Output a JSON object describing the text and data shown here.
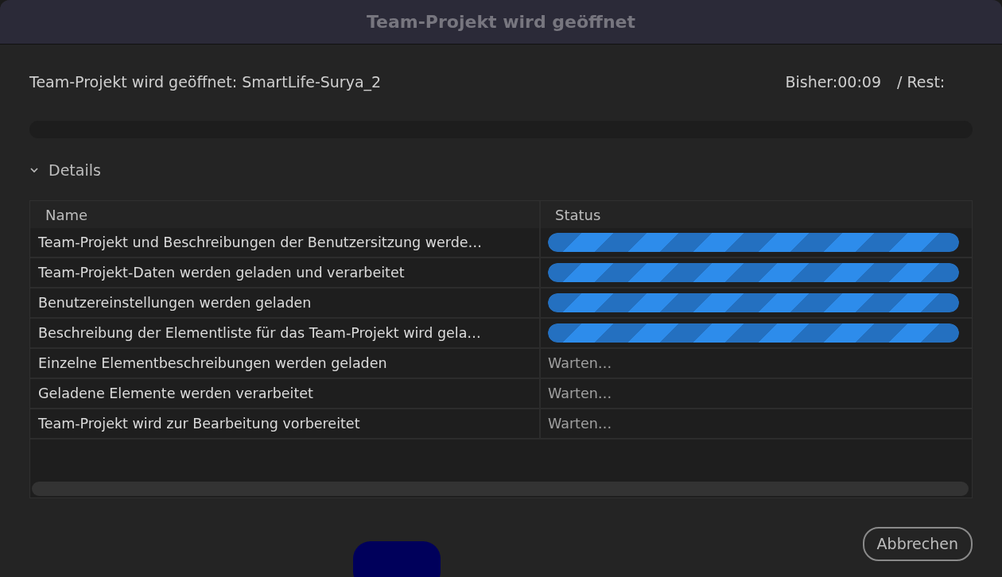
{
  "window": {
    "title": "Team-Projekt wird geöffnet"
  },
  "header": {
    "message": "Team-Projekt wird geöffnet: SmartLife-Surya_2",
    "elapsed": "Bisher:00:09",
    "remaining": "/ Rest:"
  },
  "overall_progress": {
    "level": 0
  },
  "details": {
    "label": "Details",
    "expanded": true
  },
  "table": {
    "columns": [
      "Name",
      "Status"
    ],
    "rows": [
      {
        "name": "Team-Projekt und Beschreibungen der Benutzersitzung werde…",
        "kind": "progress",
        "level": 1
      },
      {
        "name": "Team-Projekt-Daten werden geladen und verarbeitet",
        "kind": "progress",
        "level": 1
      },
      {
        "name": "Benutzereinstellungen werden geladen",
        "kind": "progress",
        "level": 1
      },
      {
        "name": "Beschreibung der Elementliste für das Team-Projekt wird gela…",
        "kind": "progress",
        "level": 1
      },
      {
        "name": "Einzelne Elementbeschreibungen werden geladen",
        "kind": "text",
        "status": "Warten…"
      },
      {
        "name": "Geladene Elemente werden verarbeitet",
        "kind": "text",
        "status": "Warten…"
      },
      {
        "name": "Team-Projekt wird zur Bearbeitung vorbereitet",
        "kind": "text",
        "status": "Warten…"
      }
    ]
  },
  "buttons": [
    "Abbrechen"
  ]
}
